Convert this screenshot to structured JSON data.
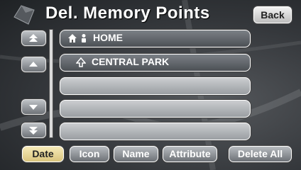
{
  "header": {
    "title": "Del. Memory Points",
    "back_label": "Back"
  },
  "list": {
    "items": [
      {
        "label": "HOME",
        "icons": [
          "home-icon",
          "person-icon"
        ]
      },
      {
        "label": "CENTRAL PARK",
        "icons": [
          "park-icon"
        ]
      },
      {
        "label": ""
      },
      {
        "label": ""
      },
      {
        "label": ""
      }
    ]
  },
  "scroll": [
    "page-up",
    "line-up",
    "line-down",
    "page-down"
  ],
  "sort_buttons": {
    "date": "Date",
    "icon": "Icon",
    "name": "Name",
    "attribute": "Attribute",
    "delete_all": "Delete All"
  },
  "colors": {
    "active_sort": "#eedd9a",
    "button": "#8a8e93",
    "background": "#3a3d41"
  }
}
